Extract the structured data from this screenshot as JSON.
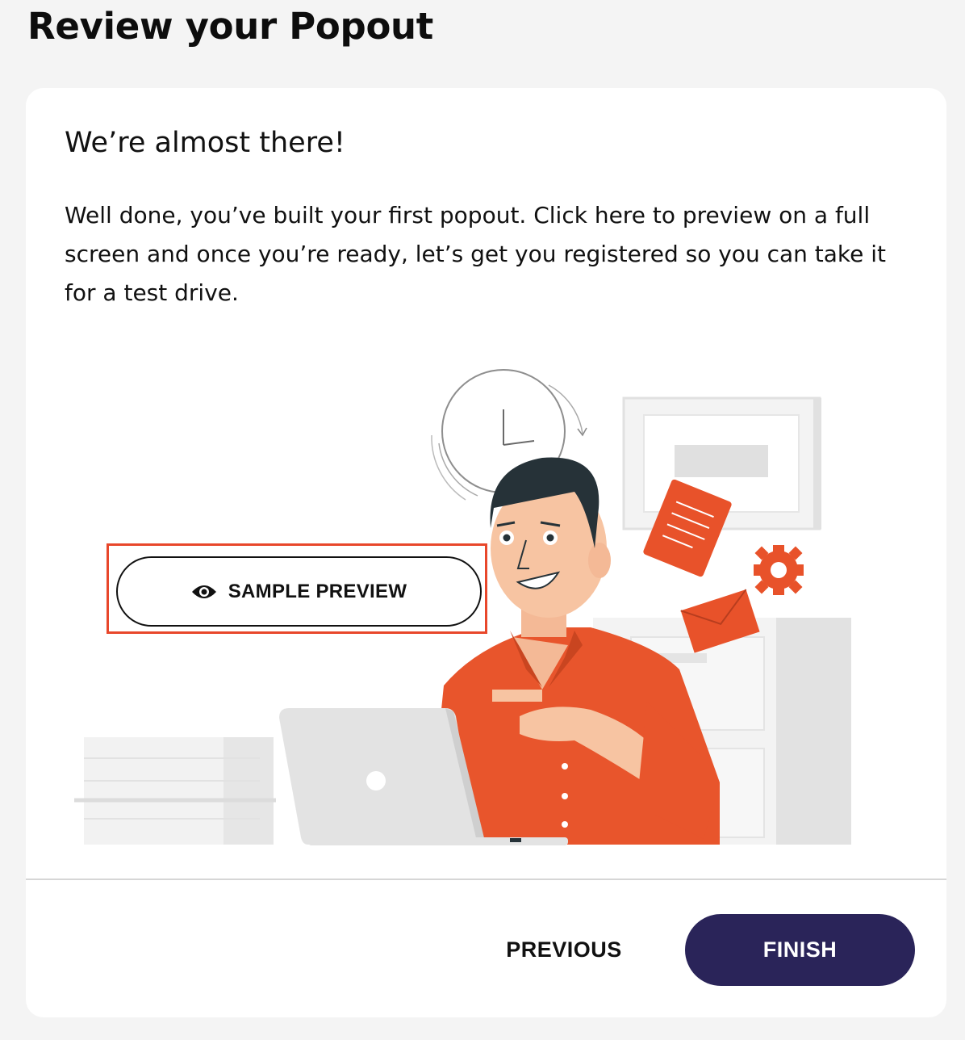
{
  "page": {
    "title": "Review your Popout"
  },
  "card": {
    "heading": "We’re almost there!",
    "body": "Well done, you’ve built your first popout. Click here to preview on a full screen and once you’re ready, let’s get you registered so you can take it for a test drive."
  },
  "preview_button": {
    "label": "SAMPLE PREVIEW",
    "icon": "eye-icon"
  },
  "footer": {
    "previous_label": "PREVIOUS",
    "finish_label": "FINISH"
  },
  "colors": {
    "accent_orange": "#e8522a",
    "finish_button": "#2a2459",
    "highlight_outline": "#e8472b",
    "page_background": "#f4f4f4"
  }
}
